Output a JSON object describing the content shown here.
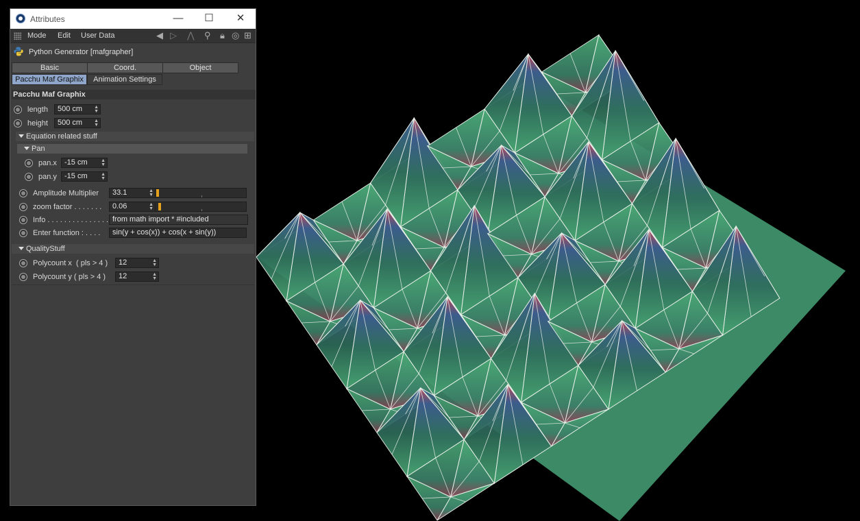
{
  "window": {
    "title": "Attributes",
    "controls": {
      "minimize": "—",
      "maximize": "☐",
      "close": "✕"
    }
  },
  "menubar": {
    "items": [
      "Mode",
      "Edit",
      "User Data"
    ],
    "icons": [
      "back-arrow-icon",
      "forward-arrow-icon",
      "up-arrow-icon",
      "search-icon",
      "lock-icon",
      "target-icon",
      "new-panel-icon"
    ]
  },
  "object": {
    "label": "Python Generator [mafgrapher]"
  },
  "tabs": {
    "row1": [
      "Basic",
      "Coord.",
      "Object"
    ],
    "row2": [
      "Pacchu Maf Graphix",
      "Animation Settings"
    ],
    "active": "Pacchu Maf Graphix"
  },
  "section": {
    "title": "Pacchu Maf Graphix",
    "length": {
      "label": "length",
      "value": "500 cm"
    },
    "height": {
      "label": "height",
      "value": "500 cm"
    }
  },
  "equation": {
    "title": "Equation related stuff",
    "pan": {
      "title": "Pan",
      "x": {
        "label": "pan.x",
        "value": "-15 cm"
      },
      "y": {
        "label": "pan.y",
        "value": "-15 cm"
      }
    },
    "amplitude": {
      "label": "Amplitude Multiplier",
      "value": "33.1",
      "slider_fraction": 0.0
    },
    "zoom": {
      "label": "zoom factor . . . . . . .",
      "value": "0.06",
      "slider_fraction": 0.02
    },
    "info": {
      "label": "Info . . . . . . . . . . . . . . .",
      "value": "from math import *  #included"
    },
    "function": {
      "label": "Enter function : . . . .",
      "value": "sin(y + cos(x)) + cos(x + sin(y))"
    }
  },
  "quality": {
    "title": "QualityStuff",
    "polyx": {
      "label": "Polycount x  ( pls > 4 )",
      "value": "12"
    },
    "polyy": {
      "label": "Polycount y ( pls > 4 )",
      "value": "12"
    }
  },
  "colors": {
    "surface_green": "#3f9a68",
    "surface_blue": "#3a5a8a",
    "peak_red": "#b04050",
    "wire": "#e8f0e8",
    "accent_tab": "#8fa5c9",
    "slider_knob": "#e6a21c"
  }
}
